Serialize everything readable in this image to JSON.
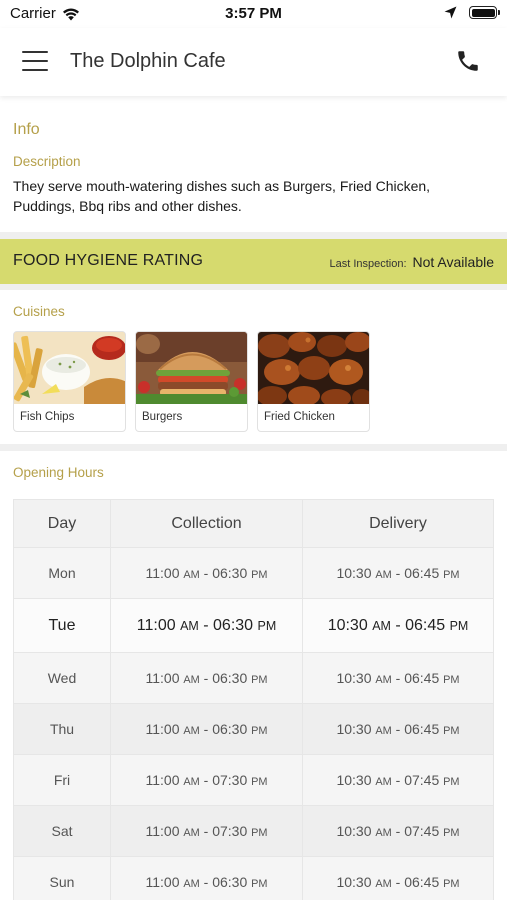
{
  "status_bar": {
    "carrier": "Carrier",
    "time": "3:57 PM"
  },
  "nav": {
    "title": "The Dolphin Cafe"
  },
  "info": {
    "title": "Info",
    "description_label": "Description",
    "description": "They serve mouth-watering dishes such as Burgers, Fried Chicken, Puddings, Bbq ribs  and other dishes."
  },
  "hygiene": {
    "title": "FOOD HYGIENE RATING",
    "inspection_label": "Last Inspection:",
    "inspection_value": "Not Available"
  },
  "cuisines": {
    "title": "Cuisines",
    "items": [
      {
        "label": "Fish  Chips",
        "icon": "fish-chips-photo"
      },
      {
        "label": "Burgers",
        "icon": "burger-photo"
      },
      {
        "label": "Fried Chicken",
        "icon": "fried-chicken-photo"
      }
    ]
  },
  "opening_hours": {
    "title": "Opening Hours",
    "headers": {
      "day": "Day",
      "collection": "Collection",
      "delivery": "Delivery"
    },
    "rows": [
      {
        "day": "Mon",
        "c_open": "11:00",
        "c_open_ampm": "AM",
        "sep": " - ",
        "c_close": "06:30",
        "c_close_ampm": "PM",
        "d_open": "10:30",
        "d_open_ampm": "AM",
        "d_close": "06:45",
        "d_close_ampm": "PM"
      },
      {
        "day": "Tue",
        "c_open": "11:00",
        "c_open_ampm": "AM",
        "sep": " - ",
        "c_close": "06:30",
        "c_close_ampm": "PM",
        "d_open": "10:30",
        "d_open_ampm": "AM",
        "d_close": "06:45",
        "d_close_ampm": "PM"
      },
      {
        "day": "Wed",
        "c_open": "11:00",
        "c_open_ampm": "AM",
        "sep": " - ",
        "c_close": "06:30",
        "c_close_ampm": "PM",
        "d_open": "10:30",
        "d_open_ampm": "AM",
        "d_close": "06:45",
        "d_close_ampm": "PM"
      },
      {
        "day": "Thu",
        "c_open": "11:00",
        "c_open_ampm": "AM",
        "sep": " - ",
        "c_close": "06:30",
        "c_close_ampm": "PM",
        "d_open": "10:30",
        "d_open_ampm": "AM",
        "d_close": "06:45",
        "d_close_ampm": "PM"
      },
      {
        "day": "Fri",
        "c_open": "11:00",
        "c_open_ampm": "AM",
        "sep": " - ",
        "c_close": "07:30",
        "c_close_ampm": "PM",
        "d_open": "10:30",
        "d_open_ampm": "AM",
        "d_close": "07:45",
        "d_close_ampm": "PM"
      },
      {
        "day": "Sat",
        "c_open": "11:00",
        "c_open_ampm": "AM",
        "sep": " - ",
        "c_close": "07:30",
        "c_close_ampm": "PM",
        "d_open": "10:30",
        "d_open_ampm": "AM",
        "d_close": "07:45",
        "d_close_ampm": "PM"
      },
      {
        "day": "Sun",
        "c_open": "11:00",
        "c_open_ampm": "AM",
        "sep": " - ",
        "c_close": "06:30",
        "c_close_ampm": "PM",
        "d_open": "10:30",
        "d_open_ampm": "AM",
        "d_close": "06:45",
        "d_close_ampm": "PM"
      }
    ],
    "highlighted_day": "Tue"
  },
  "colors": {
    "accent_gold": "#b5a04a",
    "hygiene_band": "#d6da6e",
    "separator": "#efefef"
  },
  "icons": [
    "wifi-icon",
    "location-arrow-icon",
    "battery-icon",
    "hamburger-menu-icon",
    "phone-icon"
  ]
}
